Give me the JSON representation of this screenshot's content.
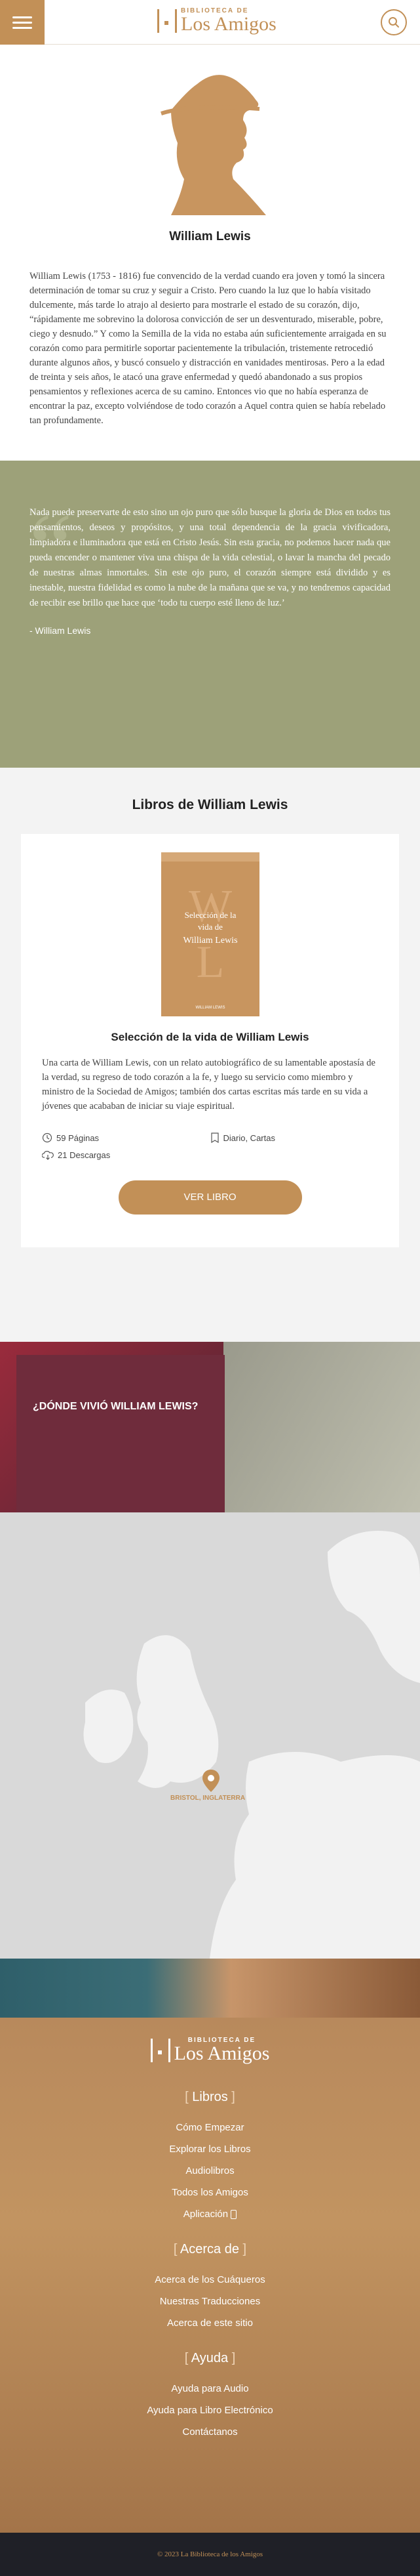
{
  "header": {
    "logo_small": "BIBLIOTECA DE",
    "logo_big": "Los Amigos",
    "menu_icon": "hamburger-icon",
    "search_icon": "search-icon"
  },
  "author": {
    "name": "William Lewis",
    "bio": "William Lewis (1753 - 1816) fue convencido de la verdad cuando era joven y tomó la sincera determinación de tomar su cruz y seguir a Cristo. Pero cuando la luz que lo había visitado dulcemente, más tarde lo atrajo al desierto para mostrarle el estado de su corazón, dijo, “rápidamente me sobrevino la dolorosa convicción de ser un desventurado, miserable, pobre, ciego y desnudo.” Y como la Semilla de la vida no estaba aún suficientemente arraigada en su corazón como para permitirle soportar pacientemente la tribulación, tristemente retrocedió durante algunos años, y buscó consuelo y distracción en vanidades mentirosas. Pero a la edad de treinta y seis años, le atacó una grave enfermedad y quedó abandonado a sus propios pensamientos y reflexiones acerca de su camino. Entonces vio que no había esperanza de encontrar la paz, excepto volviéndose de todo corazón a Aquel contra quien se había rebelado tan profundamente."
  },
  "quote": {
    "text": "Nada puede preservarte de esto sino un ojo puro que sólo busque la gloria de Dios en todos tus pensamientos, deseos y propósitos, y una total dependencia de la gracia vivificadora, limpiadora e iluminadora que está en Cristo Jesús. Sin esta gracia, no podemos hacer nada que pueda encender o mantener viva una chispa de la vida celestial, o lavar la mancha del pecado de nuestras almas inmortales. Sin este ojo puro, el corazón siempre está dividido y es inestable, nuestra fidelidad es como la nube de la mañana que se va, y no tendremos capacidad de recibir ese brillo que hace que ‘todo tu cuerpo esté lleno de luz.’",
    "author": "- William Lewis"
  },
  "books": {
    "title": "Libros de William Lewis",
    "cover_small": "BIBLIOTECA DE LOS AMIGOS",
    "cover_title_1": "Selección de la",
    "cover_title_2": "vida de",
    "cover_title_3": "William Lewis",
    "cover_footer": "WILLIAM LEWIS",
    "book_title": "Selección de la vida de William Lewis",
    "description": "Una carta de William Lewis, con un relato autobiográfico de su lamentable apostasía de la verdad, su regreso de todo corazón a la fe, y luego su servicio como miembro y ministro de la Sociedad de Amigos; también dos cartas escritas más tarde en su vida a jóvenes que acababan de iniciar su viaje espiritual.",
    "pages": "59 Páginas",
    "genre": "Diario, Cartas",
    "downloads": "21 Descargas",
    "button": "VER LIBRO"
  },
  "where": {
    "title": "¿DÓNDE VIVIÓ WILLIAM LEWIS?",
    "location": "BRISTOL, INGLATERRA"
  },
  "footer": {
    "logo_small": "BIBLIOTECA DE",
    "logo_big": "Los Amigos",
    "sections": [
      {
        "title": "Libros",
        "links": [
          "Cómo Empezar",
          "Explorar los Libros",
          "Audiolibros",
          "Todos los Amigos",
          "Aplicación"
        ]
      },
      {
        "title": "Acerca de",
        "links": [
          "Acerca de los Cuáqueros",
          "Nuestras Traducciones",
          "Acerca de este sitio"
        ]
      },
      {
        "title": "Ayuda",
        "links": [
          "Ayuda para Audio",
          "Ayuda para Libro Electrónico",
          "Contáctanos"
        ]
      }
    ],
    "copyright": "© 2023 La Biblioteca de los Amigos"
  },
  "colors": {
    "accent": "#c29057",
    "quote_bg": "#9da179",
    "where_bg": "#6f2c3c"
  }
}
